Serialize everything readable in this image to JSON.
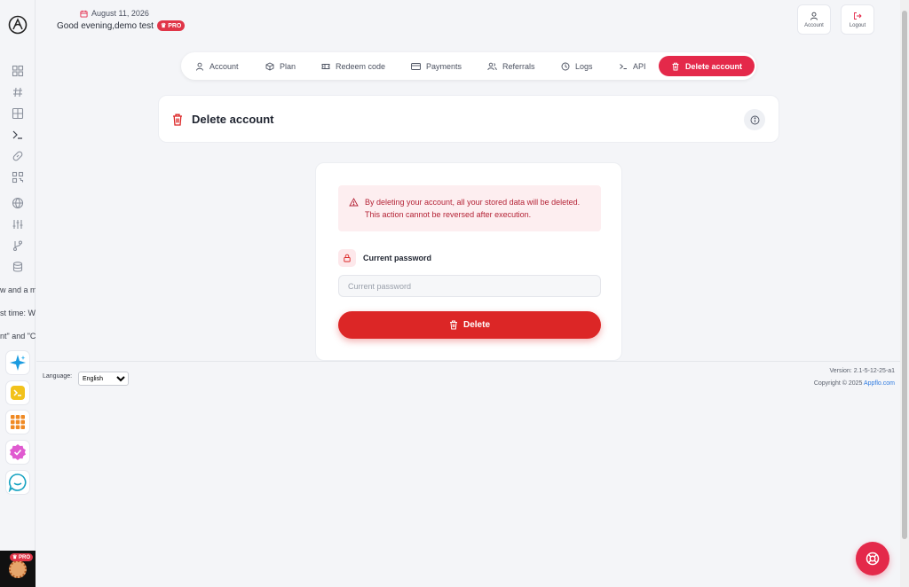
{
  "header": {
    "date": "August 11, 2026",
    "greeting": "Good evening,demo test",
    "pro_badge": "♛ PRO",
    "account_label": "Account",
    "logout_label": "Logout"
  },
  "sidebar": {
    "truncated_texts": [
      "w and a m",
      "st time: W",
      "nt\" and \"C"
    ],
    "avatar_badge": "♛ PRO"
  },
  "tabs": [
    {
      "label": "Account",
      "icon": "user-icon"
    },
    {
      "label": "Plan",
      "icon": "box-icon"
    },
    {
      "label": "Redeem code",
      "icon": "ticket-icon"
    },
    {
      "label": "Payments",
      "icon": "card-icon"
    },
    {
      "label": "Referrals",
      "icon": "users-icon"
    },
    {
      "label": "Logs",
      "icon": "clock-icon"
    },
    {
      "label": "API",
      "icon": "terminal-icon"
    },
    {
      "label": "Delete account",
      "icon": "trash-icon",
      "active": true
    }
  ],
  "page": {
    "title": "Delete account"
  },
  "form": {
    "warning": "By deleting your account, all your stored data will be deleted. This action cannot be reversed after execution.",
    "password_label": "Current password",
    "password_placeholder": "Current password",
    "password_value": "",
    "delete_label": "Delete"
  },
  "footer": {
    "language_label": "Language:",
    "language_selected": "English",
    "version": "Version: 2.1-5-12-25-a1",
    "copyright": "Copyright © 2025",
    "copyright_link": "Appflo.com"
  },
  "colors": {
    "accent": "#e4294a",
    "danger": "#dc2626",
    "background": "#f4f5f8"
  }
}
